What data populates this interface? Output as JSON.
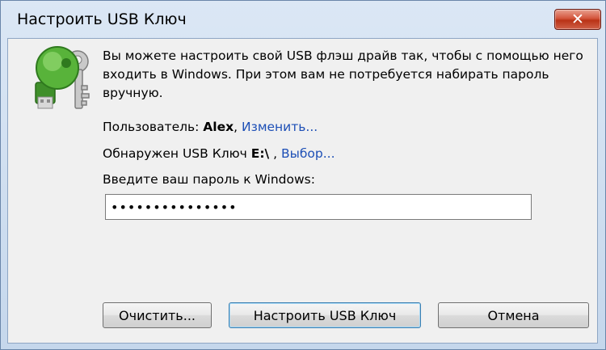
{
  "window": {
    "title": "Настроить USB Ключ",
    "close_label": "✕"
  },
  "icons": {
    "app_icon": "usb-key-icon",
    "close": "close-icon"
  },
  "intro_text": "Вы можете настроить свой USB флэш драйв так, чтобы с помощью него входить в Windows. При этом вам не потребуется набирать пароль вручную.",
  "user": {
    "prefix": "Пользователь: ",
    "name": "Alex",
    "separator": ", ",
    "change_link": "Изменить..."
  },
  "usb": {
    "prefix": "Обнаружен USB Ключ ",
    "drive": "E:\\",
    "separator": " , ",
    "select_link": "Выбор..."
  },
  "password": {
    "label": "Введите ваш пароль к Windows:",
    "value": "•••••••••••••••"
  },
  "buttons": {
    "clear": "Очистить...",
    "configure": "Настроить USB Ключ",
    "cancel": "Отмена"
  },
  "colors": {
    "link": "#1d4fb6",
    "close_button": "#c43c20",
    "key_green": "#4aa832"
  }
}
